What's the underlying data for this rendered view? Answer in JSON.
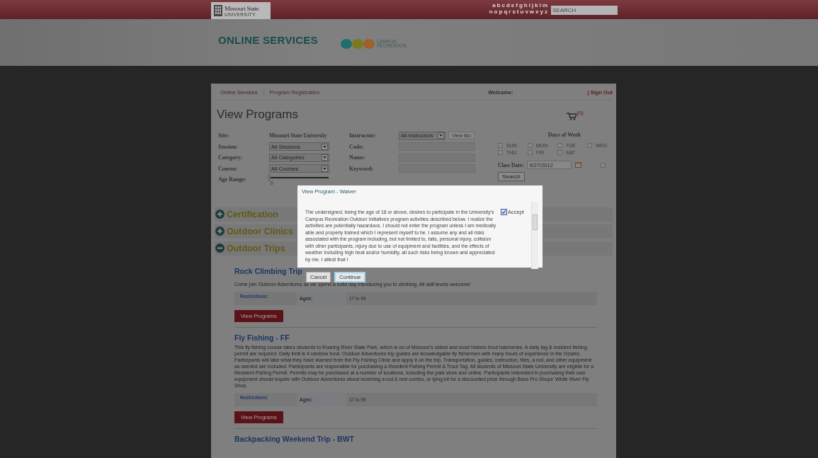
{
  "top_bar": {
    "logo_name": "Missouri State.",
    "logo_sub": "UNIVERSITY",
    "alphabet": [
      [
        "a",
        "b",
        "c",
        "d",
        "e",
        "f",
        "g",
        "h",
        "i",
        "j",
        "k",
        "l",
        "m"
      ],
      [
        "n",
        "o",
        "p",
        "q",
        "r",
        "s",
        "t",
        "u",
        "v",
        "w",
        "x",
        "y",
        "z"
      ]
    ],
    "search": {
      "placeholder": "SEARCH"
    }
  },
  "header": {
    "title": "ONLINE SERVICES",
    "brand_line1": "CAMPUS",
    "brand_line2": "RECREATION"
  },
  "breadcrumb": [
    {
      "label": "Online Services",
      "selected": false
    },
    {
      "label": "Program Registration",
      "selected": true
    }
  ],
  "welcome": "Welcome:",
  "sign_out": "| Sign Out",
  "page_title": "View Programs",
  "cart_count": "(0)",
  "filters": {
    "site_label": "Site:",
    "site_value": "Missouri State University",
    "selects": [
      {
        "label": "Session:",
        "value": "All Sessions"
      },
      {
        "label": "Category:",
        "value": "All Categories"
      },
      {
        "label": "Course:",
        "value": "All Courses"
      }
    ],
    "instructor": {
      "label": "Instructor:",
      "value": "All Instructors",
      "button": "View Bio"
    },
    "text_fields": [
      {
        "label": "Code:"
      },
      {
        "label": "Name:"
      },
      {
        "label": "Keyword:"
      }
    ],
    "age_range": {
      "label": "Age Range:",
      "level": 0,
      "reading": "0"
    },
    "days_title": "Days of Week",
    "days": [
      {
        "label": "SUN",
        "checked": false
      },
      {
        "label": "MON",
        "checked": false
      },
      {
        "label": "TUE",
        "checked": false
      },
      {
        "label": "WED",
        "checked": false
      },
      {
        "label": "THU",
        "checked": false
      },
      {
        "label": "FRI",
        "checked": false
      },
      {
        "label": "SAT",
        "checked": false
      }
    ],
    "class_date": {
      "label": "Class Date:",
      "value": "9/27/2012",
      "checked": false
    },
    "search_button": "Search"
  },
  "categories": [
    {
      "title": "Certification",
      "expanded": false
    },
    {
      "title": "Outdoor Clinics",
      "expanded": false
    },
    {
      "title": "Outdoor Trips",
      "expanded": true,
      "programs": [
        {
          "title": "Rock Climbing Trip",
          "description": "Come join Outdoor Adventures as we spend a solid day introducing you to climbing. All skill levels welcome!",
          "restrictions_label": "Restrictions:",
          "ages_label": "Ages:",
          "ages": "17 to 99",
          "button": "View Programs"
        },
        {
          "title": "Fly Fishing - FF",
          "description": "This fly fishing course takes students to Roaring River State Park, which is on of Missouri's oldest and most historic trout hatcheries. A daily tag & resident fishing permit are required. Daily limit is 4 rainbow trout. Outdoor Adventures trip guides are knowledgable fly fishermen with many hours of experience in the Ozarks. Participants will take what they have learned from the Fly Fishing Clinic and apply it on the trip. Transportation, guides, instruction, flies, a rod, and other equipment as needed are included. Participants are responsible for purchasing a Resident Fishing Permit & Trout Tag. All students of Missouri State University are eligible for a Resident Fishing Permit. Permits may be purchased at a number of locations, including the park store and online. Participants interested in purchasing their own equipment should inquire with Outdoor Adventures about receiving a rod & reel combo, or tying kit for a discounted price through Bass Pro Shops' White River Fly Shop.",
          "restrictions_label": "Restrictions:",
          "ages_label": "Ages:",
          "ages": "17 to 99",
          "button": "View Programs"
        },
        {
          "title": "Backpacking Weekend Trip - BWT"
        }
      ]
    }
  ],
  "modal": {
    "title": "View Program - Waiver",
    "text": "The undersigned, being the age of 18 or above, desires to participate in the University's Campus Recreation Outdoor Initiatives program activities described below. I realize the activities are potentially hazardous. I should not enter the program unless I am medically able and properly trained which I represent myself to be. I assume any and all risks associated with the program including, but not limited to, falls, personal injury, collision with other participants, injury due to use of equipment and facilities, and the effects of weather including high heat and/or humidity, all such risks being known and appreciated by me. I attest that I",
    "accept": {
      "label": "Accept",
      "checked": true
    },
    "buttons": [
      {
        "label": "Cancel",
        "selected": false
      },
      {
        "label": "Continue",
        "selected": true
      }
    ]
  }
}
